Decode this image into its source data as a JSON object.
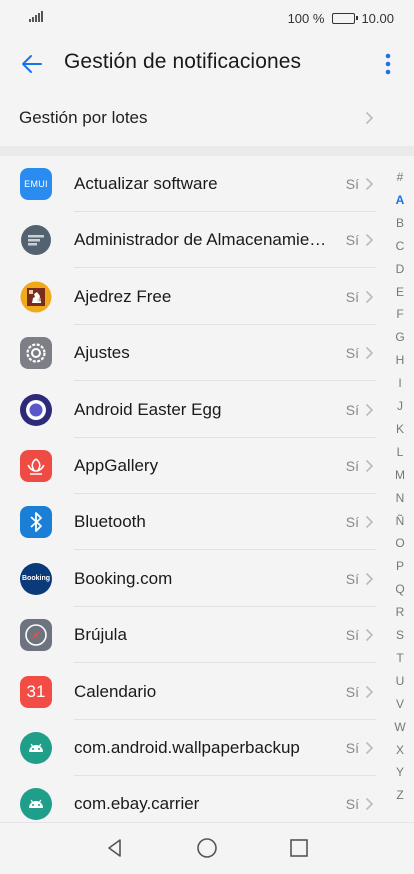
{
  "status_bar": {
    "battery_percent": "100 %",
    "time": "10.00",
    "battery_level": 1.0
  },
  "header": {
    "title": "Gestión de notificaciones"
  },
  "batch": {
    "label": "Gestión por lotes"
  },
  "apps": [
    {
      "name": "Actualizar software",
      "status": "Sí",
      "icon": "emui-update-icon",
      "icon_text": "EMUI"
    },
    {
      "name": "Administrador de Almacenamiento",
      "status": "Sí",
      "icon": "storage-manager-icon"
    },
    {
      "name": "Ajedrez Free",
      "status": "Sí",
      "icon": "chess-icon"
    },
    {
      "name": "Ajustes",
      "status": "Sí",
      "icon": "settings-gear-icon"
    },
    {
      "name": "Android Easter Egg",
      "status": "Sí",
      "icon": "easter-egg-icon"
    },
    {
      "name": "AppGallery",
      "status": "Sí",
      "icon": "appgallery-icon"
    },
    {
      "name": "Bluetooth",
      "status": "Sí",
      "icon": "bluetooth-icon"
    },
    {
      "name": "Booking.com",
      "status": "Sí",
      "icon": "booking-icon",
      "icon_text": "Booking"
    },
    {
      "name": "Brújula",
      "status": "Sí",
      "icon": "compass-icon"
    },
    {
      "name": "Calendario",
      "status": "Sí",
      "icon": "calendar-icon",
      "icon_text": "31"
    },
    {
      "name": "com.android.wallpaperbackup",
      "status": "Sí",
      "icon": "android-icon"
    },
    {
      "name": "com.ebay.carrier",
      "status": "Sí",
      "icon": "android-icon"
    }
  ],
  "index_letters": [
    "#",
    "A",
    "B",
    "C",
    "D",
    "E",
    "F",
    "G",
    "H",
    "I",
    "J",
    "K",
    "L",
    "M",
    "N",
    "Ñ",
    "O",
    "P",
    "Q",
    "R",
    "S",
    "T",
    "U",
    "V",
    "W",
    "X",
    "Y",
    "Z"
  ],
  "active_index": "A",
  "colors": {
    "accent": "#1a73e8",
    "background": "#f4f4f4"
  }
}
